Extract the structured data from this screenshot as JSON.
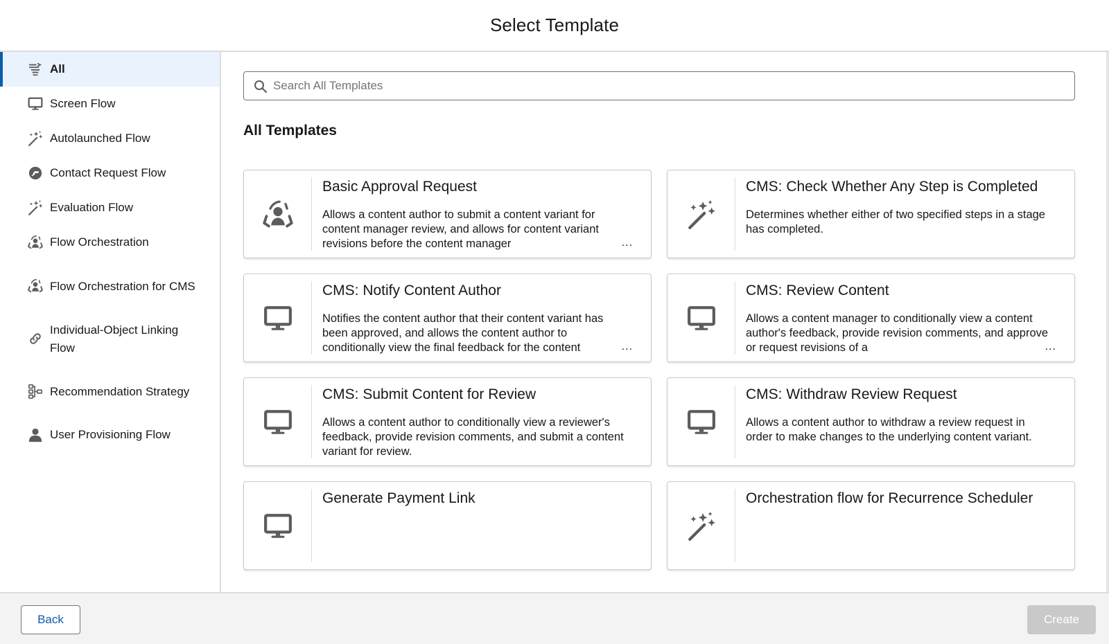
{
  "header": {
    "title": "Select Template"
  },
  "sidebar": {
    "items": [
      {
        "label": "All",
        "icon": "all-types-icon",
        "active": true
      },
      {
        "label": "Screen Flow",
        "icon": "desktop-icon"
      },
      {
        "label": "Autolaunched Flow",
        "icon": "magic-wand-icon"
      },
      {
        "label": "Contact Request Flow",
        "icon": "contact-request-icon"
      },
      {
        "label": "Evaluation Flow",
        "icon": "magic-wand-icon"
      },
      {
        "label": "Flow Orchestration",
        "icon": "orchestration-icon"
      },
      {
        "label": "Flow Orchestration for CMS",
        "icon": "orchestration-icon"
      },
      {
        "label": "Individual-Object Linking Flow",
        "icon": "link-icon"
      },
      {
        "label": "Recommendation Strategy",
        "icon": "strategy-icon"
      },
      {
        "label": "User Provisioning Flow",
        "icon": "user-icon"
      }
    ]
  },
  "search": {
    "placeholder": "Search All Templates",
    "value": ""
  },
  "main": {
    "section_title": "All Templates"
  },
  "templates": [
    {
      "title": "Basic Approval Request",
      "description": "Allows a content author to submit a content variant for content manager review, and allows for content variant revisions before the content manager",
      "truncated": true,
      "icon": "orchestration-icon"
    },
    {
      "title": "CMS: Check Whether Any Step is Completed",
      "description": "Determines whether either of two specified steps in a stage has completed.",
      "truncated": false,
      "icon": "magic-wand-icon"
    },
    {
      "title": "CMS: Notify Content Author",
      "description": "Notifies the content author that their content variant has been approved, and allows the content author to conditionally view the final feedback for the content",
      "truncated": true,
      "icon": "desktop-icon"
    },
    {
      "title": "CMS: Review Content",
      "description": "Allows a content manager to conditionally view a content author's feedback, provide revision comments, and approve or request revisions of a",
      "truncated": true,
      "icon": "desktop-icon"
    },
    {
      "title": "CMS: Submit Content for Review",
      "description": "Allows a content author to conditionally view a reviewer's feedback, provide revision comments, and submit a content variant for review.",
      "truncated": false,
      "icon": "desktop-icon"
    },
    {
      "title": "CMS: Withdraw Review Request",
      "description": "Allows a content author to withdraw a review request in order to make changes to the underlying content variant.",
      "truncated": false,
      "icon": "desktop-icon"
    },
    {
      "title": "Generate Payment Link",
      "description": "",
      "truncated": false,
      "icon": "desktop-icon"
    },
    {
      "title": "Orchestration flow for Recurrence Scheduler",
      "description": "",
      "truncated": false,
      "icon": "magic-wand-icon"
    }
  ],
  "more_indicator": "...",
  "footer": {
    "back_label": "Back",
    "create_label": "Create"
  },
  "colors": {
    "brand": "#0b5cab",
    "active_bg": "#eaf2fe",
    "icon_gray": "#5c5c5c",
    "disabled_button": "#c9c9c9"
  }
}
